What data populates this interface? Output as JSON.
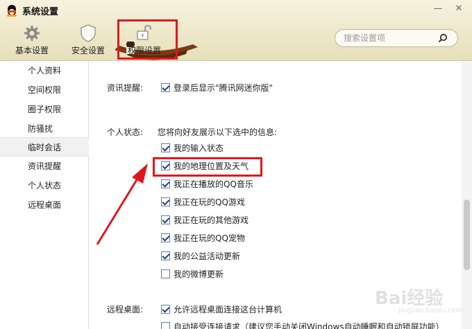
{
  "window": {
    "title": "系统设置",
    "minimize_glyph": "—",
    "close_glyph": "✕"
  },
  "tabs": [
    {
      "label": "基本设置",
      "icon": "gear-icon"
    },
    {
      "label": "安全设置",
      "icon": "shield-icon"
    },
    {
      "label": "权限设置",
      "icon": "unlock-icon"
    }
  ],
  "search": {
    "placeholder": "搜索设置项",
    "icon": "search-icon"
  },
  "sidebar": {
    "items": [
      {
        "label": "个人资料"
      },
      {
        "label": "空间权限"
      },
      {
        "label": "圈子权限"
      },
      {
        "label": "防骚扰"
      },
      {
        "label": "临时会话"
      },
      {
        "label": "资讯提醒"
      },
      {
        "label": "个人状态"
      },
      {
        "label": "远程桌面"
      }
    ],
    "active": "临时会话"
  },
  "content": {
    "news": {
      "label": "资讯提醒:",
      "option": "登录后显示\"腾讯网迷你版\"",
      "checked": true
    },
    "status": {
      "label": "个人状态:",
      "description": "您将向好友展示以下选中的信息:",
      "options": [
        {
          "label": "我的输入状态",
          "checked": true
        },
        {
          "label": "我的地理位置及天气",
          "checked": true
        },
        {
          "label": "我正在播放的QQ音乐",
          "checked": true
        },
        {
          "label": "我正在玩的QQ游戏",
          "checked": true
        },
        {
          "label": "我正在玩的其他游戏",
          "checked": true
        },
        {
          "label": "我正在玩的QQ宠物",
          "checked": true
        },
        {
          "label": "我的公益活动更新",
          "checked": true
        },
        {
          "label": "我的微博更新",
          "checked": false
        }
      ]
    },
    "remote": {
      "label": "远程桌面:",
      "options": [
        {
          "label": "允许远程桌面连接这台计算机",
          "checked": true
        },
        {
          "label": "自动接受连接请求（建议您手动关闭Windows自动睡眠和自动锁屏功能）",
          "checked": false
        }
      ]
    }
  },
  "colors": {
    "highlight": "#e0161c",
    "header_bg": "#ede7c8",
    "check": "#1b3f8c"
  },
  "watermark": {
    "text": "Bai经验",
    "sub": "jingyan.baidu.com"
  }
}
